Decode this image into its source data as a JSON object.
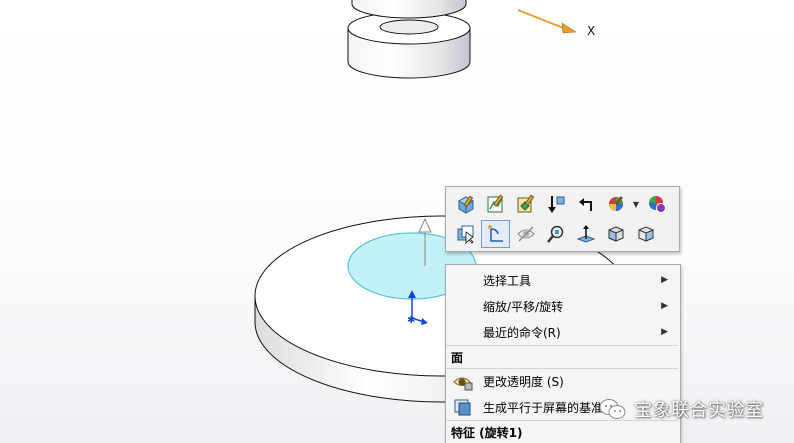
{
  "viewport": {
    "axis_x_label": "X"
  },
  "toolbar": {
    "row1": [
      "edit-feature-icon",
      "edit-sketch-icon",
      "edit-part-icon",
      "insert-icon",
      "back-icon",
      "appearance-icon",
      "dropdown-arrow-icon",
      "scene-icon"
    ],
    "row2": [
      "select-other-icon",
      "sketch-icon",
      "hide-icon",
      "zoom-to-selection-icon",
      "normal-to-icon",
      "view-orientation-icon",
      "isometric-icon"
    ]
  },
  "menu": {
    "select_tools": "选择工具",
    "zoom_pan_rotate": "缩放/平移/旋转",
    "recent_commands": "最近的命令(R)",
    "face_header": "面",
    "change_transparency": "更改透明度 (S)",
    "create_plane_parallel": "生成平行于屏幕的基准面",
    "feature_header": "特征 (旋转1)"
  },
  "watermark": {
    "text": "宝象联合实验室"
  },
  "colors": {
    "selected_face": "#bff0f7",
    "axis_x": "#e69b2a",
    "axis_y": "#0a3ad6"
  }
}
